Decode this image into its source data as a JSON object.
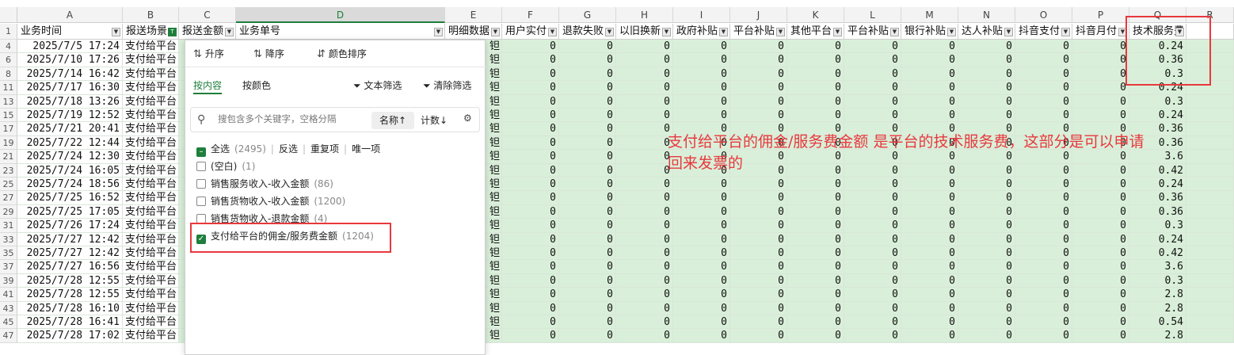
{
  "columns": [
    {
      "letter": "A",
      "field": "业务时间",
      "active": false
    },
    {
      "letter": "B",
      "field": "报送场景",
      "active": true
    },
    {
      "letter": "C",
      "field": "报送金额",
      "active": false
    },
    {
      "letter": "D",
      "field": "业务单号",
      "active": false
    },
    {
      "letter": "E",
      "field": "明细数据",
      "active": false
    },
    {
      "letter": "F",
      "field": "用户实付",
      "active": false
    },
    {
      "letter": "G",
      "field": "退款失败",
      "active": false
    },
    {
      "letter": "H",
      "field": "以旧换新",
      "active": false
    },
    {
      "letter": "I",
      "field": "政府补贴",
      "active": false
    },
    {
      "letter": "J",
      "field": "平台补贴",
      "active": false
    },
    {
      "letter": "K",
      "field": "其他平台",
      "active": false
    },
    {
      "letter": "L",
      "field": "平台补贴",
      "active": false
    },
    {
      "letter": "M",
      "field": "银行补贴",
      "active": false
    },
    {
      "letter": "N",
      "field": "达人补贴",
      "active": false
    },
    {
      "letter": "O",
      "field": "抖音支付",
      "active": false
    },
    {
      "letter": "P",
      "field": "抖音月付",
      "active": false
    },
    {
      "letter": "Q",
      "field": "技术服务费",
      "active": false
    },
    {
      "letter": "R",
      "field": "",
      "active": false
    }
  ],
  "rows": [
    {
      "num": "4",
      "time": "2025/7/5 17:24",
      "scene": "支付给平台",
      "q": "0.24"
    },
    {
      "num": "6",
      "time": "2025/7/10 17:26",
      "scene": "支付给平台",
      "q": "0.36"
    },
    {
      "num": "8",
      "time": "2025/7/14 16:42",
      "scene": "支付给平台",
      "q": "0.3"
    },
    {
      "num": "11",
      "time": "2025/7/17 16:30",
      "scene": "支付给平台",
      "q": "0.24"
    },
    {
      "num": "13",
      "time": "2025/7/18 13:26",
      "scene": "支付给平台",
      "q": "0.3"
    },
    {
      "num": "15",
      "time": "2025/7/19 12:52",
      "scene": "支付给平台",
      "q": "0.24"
    },
    {
      "num": "17",
      "time": "2025/7/21 20:41",
      "scene": "支付给平台",
      "q": "0.36"
    },
    {
      "num": "19",
      "time": "2025/7/22 12:44",
      "scene": "支付给平台",
      "q": "0.36"
    },
    {
      "num": "21",
      "time": "2025/7/24 12:30",
      "scene": "支付给平台",
      "q": "3.6"
    },
    {
      "num": "23",
      "time": "2025/7/24 16:05",
      "scene": "支付给平台",
      "q": "0.42"
    },
    {
      "num": "25",
      "time": "2025/7/24 18:56",
      "scene": "支付给平台",
      "q": "0.24"
    },
    {
      "num": "27",
      "time": "2025/7/25 16:52",
      "scene": "支付给平台",
      "q": "0.36"
    },
    {
      "num": "29",
      "time": "2025/7/25 17:05",
      "scene": "支付给平台",
      "q": "0.36"
    },
    {
      "num": "31",
      "time": "2025/7/26 17:24",
      "scene": "支付给平台",
      "q": "0.3"
    },
    {
      "num": "33",
      "time": "2025/7/27 12:42",
      "scene": "支付给平台",
      "q": "0.24"
    },
    {
      "num": "35",
      "time": "2025/7/27 12:42",
      "scene": "支付给平台",
      "q": "0.42"
    },
    {
      "num": "37",
      "time": "2025/7/27 16:56",
      "scene": "支付给平台",
      "q": "3.6"
    },
    {
      "num": "39",
      "time": "2025/7/28 12:55",
      "scene": "支付给平台",
      "q": "0.3"
    },
    {
      "num": "41",
      "time": "2025/7/28 12:55",
      "scene": "支付给平台",
      "q": "2.8"
    },
    {
      "num": "43",
      "time": "2025/7/28 16:10",
      "scene": "支付给平台",
      "q": "2.8"
    },
    {
      "num": "45",
      "time": "2025/7/28 16:41",
      "scene": "支付给平台",
      "q": "0.54"
    },
    {
      "num": "47",
      "time": "2025/7/28 17:02",
      "scene": "支付给平台",
      "q": "2.8"
    }
  ],
  "row_header_first": "1",
  "zero_value": "0",
  "e_fragment": "钽",
  "filter_panel": {
    "sort_asc": "升序",
    "sort_desc": "降序",
    "sort_color": "颜色排序",
    "tab_content": "按内容",
    "tab_color": "按颜色",
    "text_filter": "文本筛选",
    "clear_filter": "清除筛选",
    "search_placeholder": "搜包含多个关键字，空格分隔",
    "sort_name": "名称↑",
    "sort_count": "计数↓",
    "select_all": "全选",
    "select_all_count": "(2495)",
    "invert": "反选",
    "duplicates": "重复项",
    "unique": "唯一项",
    "items": [
      {
        "label": "(空白)",
        "count": "(1)",
        "checked": false
      },
      {
        "label": "销售服务收入-收入金额",
        "count": "(86)",
        "checked": false
      },
      {
        "label": "销售货物收入-收入金额",
        "count": "(1200)",
        "checked": false
      },
      {
        "label": "销售货物收入-退款金额",
        "count": "(4)",
        "checked": false
      },
      {
        "label": "支付给平台的佣金/服务费金额",
        "count": "(1204)",
        "checked": true
      }
    ]
  },
  "annotation_text": "支付给平台的佣金/服务费金额 是平台的技术服务费，这部分是可以申请回来发票的",
  "colors": {
    "accent": "#1e7f3c",
    "highlight": "#e8383d",
    "cell_green": "#d9efd9"
  }
}
